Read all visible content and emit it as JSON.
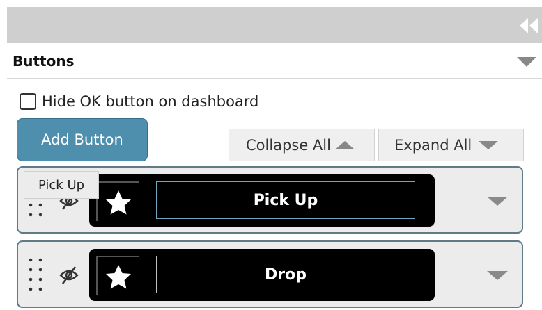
{
  "panel": {
    "collapse_icon": "double-chevron-left-icon",
    "section_title": "Buttons"
  },
  "options": {
    "hide_ok_label": "Hide OK button on dashboard",
    "hide_ok_checked": false
  },
  "toolbar": {
    "add_button_label": "Add Button",
    "collapse_all_label": "Collapse All",
    "expand_all_label": "Expand All"
  },
  "buttons": [
    {
      "label": "Pick Up",
      "icon": "star-icon",
      "visibility_icon": "eye-slash-icon"
    },
    {
      "label": "Drop",
      "icon": "star-icon",
      "visibility_icon": "eye-slash-icon"
    }
  ],
  "tooltip": {
    "text": "Pick Up"
  },
  "colors": {
    "accent": "#4f8fae",
    "preview_bg": "#000000"
  }
}
